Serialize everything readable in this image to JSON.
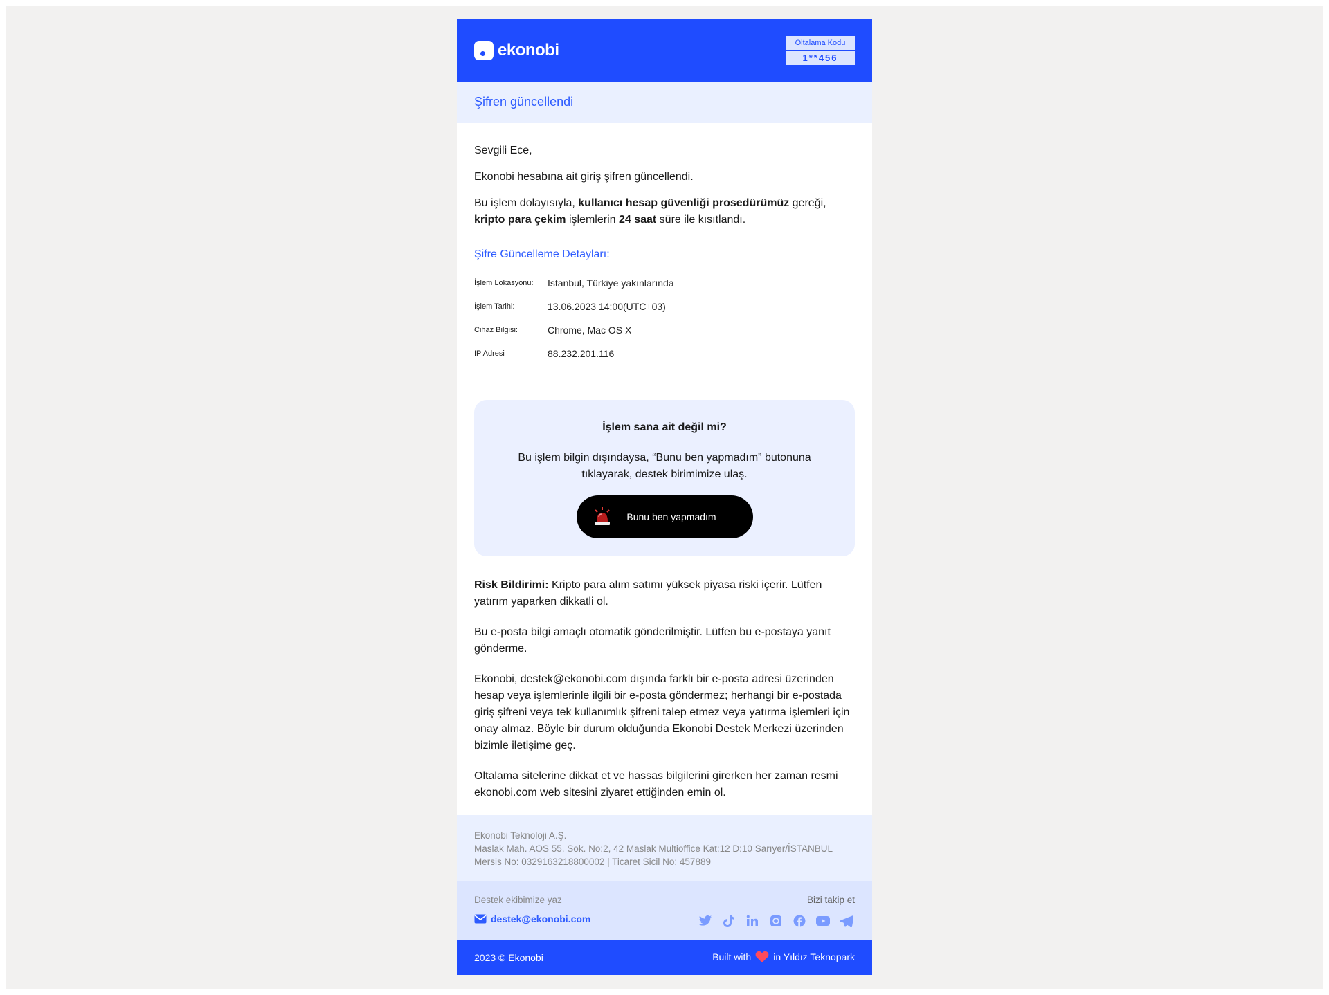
{
  "header": {
    "logo_text": "ekonobi",
    "phishing_label": "Oltalama Kodu",
    "phishing_code": "1**456",
    "brand_color": "#1f4cff"
  },
  "band": {
    "title": "Şifren güncellendi"
  },
  "body": {
    "greeting": "Sevgili Ece,",
    "line1": "Ekonobi hesabına ait giriş şifren güncellendi.",
    "line2_a": "Bu işlem dolayısıyla, ",
    "line2_b": "kullanıcı hesap güvenliği prosedürümüz",
    "line2_c": " gereği,",
    "line2_d": "kripto para çekim",
    "line2_e": " işlemlerin ",
    "line2_f": "24 saat",
    "line2_g": " süre ile kısıtlandı."
  },
  "details": {
    "title": "Şifre Güncelleme Detayları:",
    "rows": [
      {
        "key": "İşlem Lokasyonu:",
        "value": "Istanbul, Türkiye yakınlarında"
      },
      {
        "key": "İşlem Tarihi:",
        "value": "13.06.2023 14:00(UTC+03)"
      },
      {
        "key": "Cihaz Bilgisi:",
        "value": "Chrome, Mac OS X"
      },
      {
        "key": "IP Adresi",
        "value": "88.232.201.116"
      }
    ]
  },
  "alert": {
    "title": "İşlem sana ait değil mi?",
    "text": "Bu işlem bilgin dışındaysa, “Bunu ben yapmadım” butonuna tıklayarak, destek birimimize ulaş.",
    "button_label": "Bunu ben yapmadım",
    "button_icon": "siren-icon"
  },
  "notices": {
    "risk_label": "Risk Bildirimi:",
    "risk_text": " Kripto para alım satımı yüksek piyasa riski içerir. Lütfen yatırım yaparken dikkatli ol.",
    "auto_text": "Bu e-posta bilgi amaçlı otomatik gönderilmiştir. Lütfen bu e-postaya yanıt gönderme.",
    "security_text": "Ekonobi, destek@ekonobi.com dışında farklı bir e-posta adresi üzerinden hesap veya işlemlerinle ilgili bir e-posta göndermez; herhangi bir e-postada giriş şifreni veya tek kullanımlık şifreni talep etmez veya yatırma işlemleri için onay almaz. Böyle bir durum olduğunda Ekonobi Destek Merkezi üzerinden bizimle iletişime geç.",
    "phishing_text": "Oltalama sitelerine dikkat et ve hassas bilgilerini girerken her zaman resmi ekonobi.com web sitesini ziyaret ettiğinden emin ol."
  },
  "footer": {
    "company": "Ekonobi Teknoloji A.Ş.",
    "address": "Maslak Mah. AOS 55. Sok. No:2, 42 Maslak Multioffice Kat:12 D:10 Sarıyer/İSTANBUL",
    "registry": "Mersis No: 0329163218800002 | Ticaret Sicil No: 457889",
    "support_label": "Destek ekibimize yaz",
    "support_email": "destek@ekonobi.com",
    "follow_label": "Bizi takip et",
    "socials": [
      "twitter-icon",
      "tiktok-icon",
      "linkedin-icon",
      "instagram-icon",
      "facebook-icon",
      "youtube-icon",
      "telegram-icon"
    ],
    "copyright": "2023 © Ekonobi",
    "built_with": "Built with",
    "built_in": "in Yıldız Teknopark",
    "heart_color": "#ff4b5c"
  }
}
